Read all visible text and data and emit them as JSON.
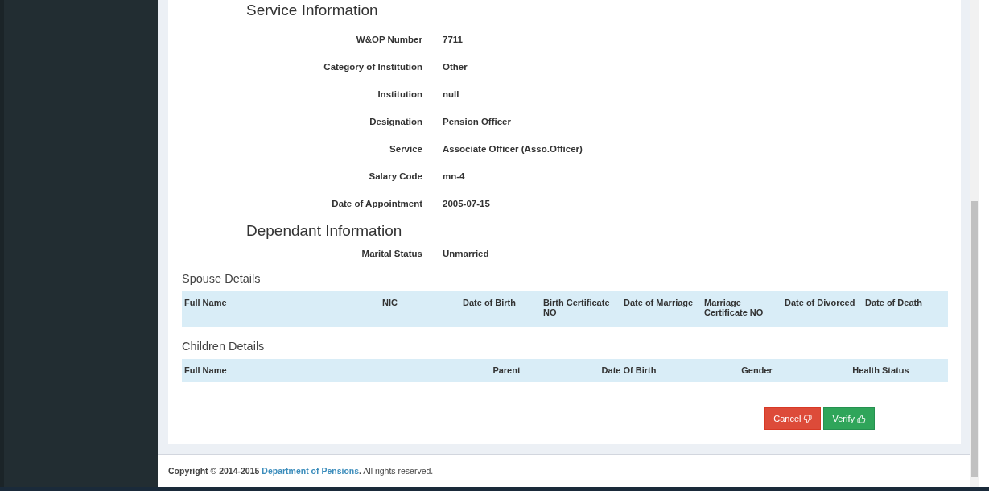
{
  "service_information": {
    "heading": "Service Information",
    "fields": [
      {
        "label": "W&OP Number",
        "value": "7711"
      },
      {
        "label": "Category of Institution",
        "value": "Other"
      },
      {
        "label": "Institution",
        "value": "null"
      },
      {
        "label": "Designation",
        "value": "Pension Officer"
      },
      {
        "label": "Service",
        "value": "Associate Officer (Asso.Officer)"
      },
      {
        "label": "Salary Code",
        "value": "mn-4"
      },
      {
        "label": "Date of Appointment",
        "value": "2005-07-15"
      }
    ]
  },
  "dependant_information": {
    "heading": "Dependant Information",
    "fields": [
      {
        "label": "Marital Status",
        "value": "Unmarried"
      }
    ]
  },
  "spouse_details": {
    "title": "Spouse Details",
    "columns": [
      "Full Name",
      "NIC",
      "Date of Birth",
      "Birth Certificate NO",
      "Date of Marriage",
      "Marriage Certificate NO",
      "Date of Divorced",
      "Date of Death"
    ]
  },
  "children_details": {
    "title": "Children Details",
    "columns": [
      "Full Name",
      "Parent",
      "Date Of Birth",
      "Gender",
      "Health Status"
    ]
  },
  "buttons": [
    {
      "kind": "cancel",
      "label": "Cancel"
    },
    {
      "kind": "verify",
      "label": "Verify"
    }
  ],
  "footer": {
    "prefix": "Copyright © 2014-2015",
    "link": "Department of Pensions",
    "suffix": "**.** All rights reserved."
  }
}
